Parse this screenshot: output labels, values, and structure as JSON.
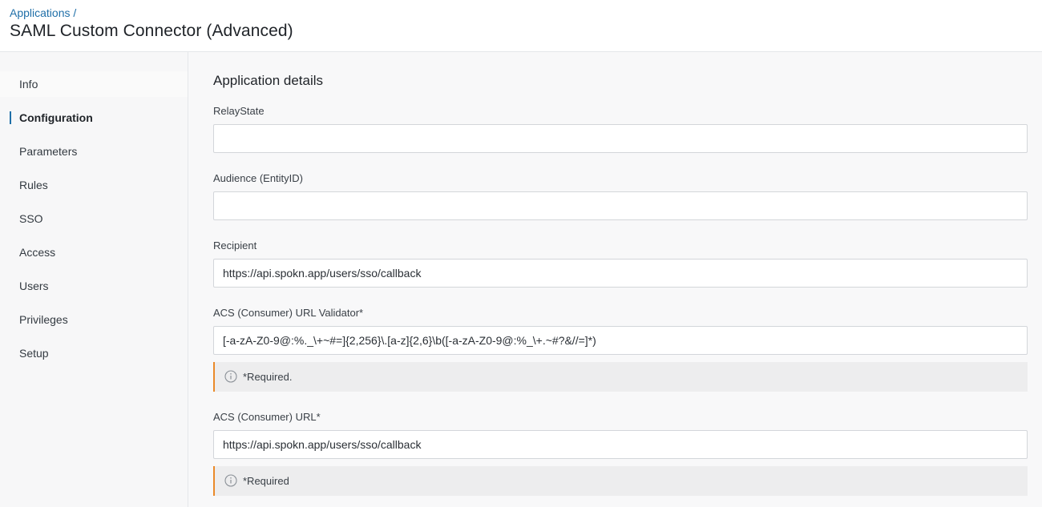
{
  "header": {
    "breadcrumb": "Applications /",
    "title": "SAML Custom Connector (Advanced)"
  },
  "sidebar": {
    "items": [
      {
        "label": "Info"
      },
      {
        "label": "Configuration",
        "active": true
      },
      {
        "label": "Parameters"
      },
      {
        "label": "Rules"
      },
      {
        "label": "SSO"
      },
      {
        "label": "Access"
      },
      {
        "label": "Users"
      },
      {
        "label": "Privileges"
      },
      {
        "label": "Setup"
      }
    ]
  },
  "main": {
    "section_title": "Application details",
    "fields": [
      {
        "label": "RelayState",
        "value": ""
      },
      {
        "label": "Audience (EntityID)",
        "value": ""
      },
      {
        "label": "Recipient",
        "value": "https://api.spokn.app/users/sso/callback"
      },
      {
        "label": "ACS (Consumer) URL Validator*",
        "value": "[-a-zA-Z0-9@:%._\\+~#=]{2,256}\\.[a-z]{2,6}\\b([-a-zA-Z0-9@:%_\\+.~#?&//=]*)",
        "note": "*Required."
      },
      {
        "label": "ACS (Consumer) URL*",
        "value": "https://api.spokn.app/users/sso/callback",
        "note": "*Required"
      }
    ]
  },
  "colors": {
    "accent": "#1f6fa8",
    "warning": "#ea8a2a",
    "sidebar_bg": "#f7f7f8"
  }
}
